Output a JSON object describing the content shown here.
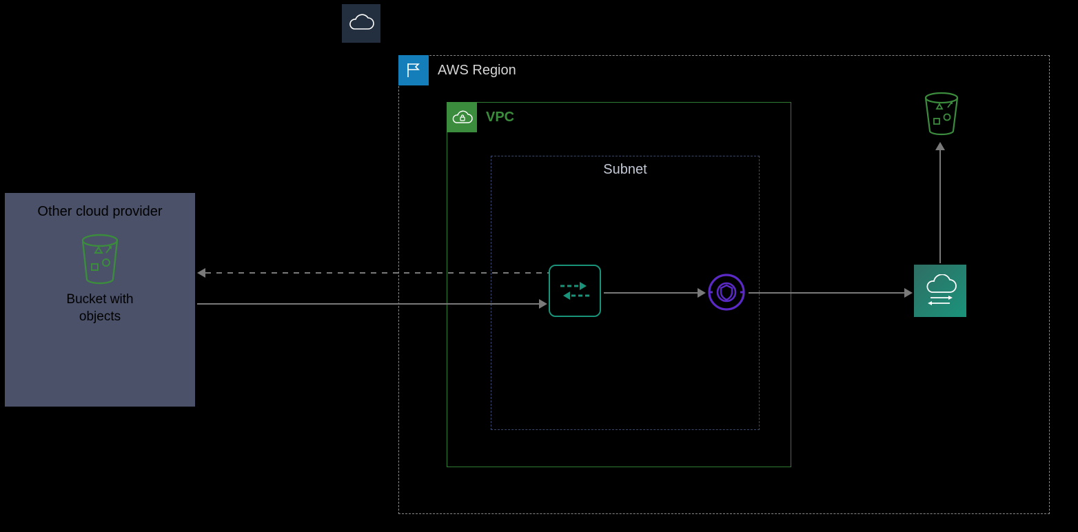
{
  "aws_cloud": {
    "icon": "cloud-icon"
  },
  "region": {
    "label": "AWS Region"
  },
  "vpc": {
    "label": "VPC"
  },
  "subnet": {
    "label": "Subnet"
  },
  "other_cloud": {
    "title": "Other cloud provider",
    "bucket_label_line1": "Bucket with",
    "bucket_label_line2": "objects"
  },
  "nodes": {
    "gateway": "internet-gateway",
    "privatelink": "privatelink-endpoint",
    "datasync": "datasync-agent",
    "s3": "s3-bucket"
  },
  "colors": {
    "region_border": "#8a8a8a",
    "region_badge": "#147eba",
    "vpc": "#3c8c3e",
    "subnet_border": "#3b4a6e",
    "other_cloud_bg": "#4a5169",
    "gateway_border": "#1a937b",
    "privatelink": "#5b2ac6",
    "s3": "#3c8c3e",
    "arrow": "#7a7a7a"
  }
}
